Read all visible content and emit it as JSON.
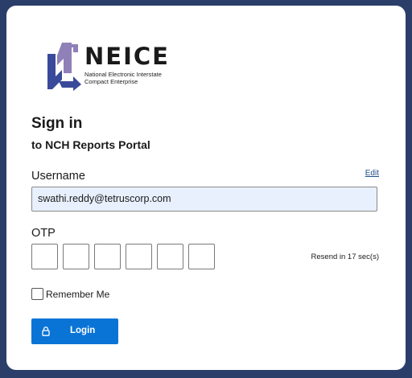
{
  "logo": {
    "wordmark": "NEICE",
    "tagline_line1": "National Electronic Interstate",
    "tagline_line2": "Compact Enterprise",
    "colors": {
      "blue": "#3a4a9a",
      "purple": "#8f80b8"
    }
  },
  "page": {
    "title": "Sign in",
    "subtitle": "to NCH Reports Portal"
  },
  "username": {
    "label": "Username",
    "edit_label": "Edit",
    "value": "swathi.reddy@tetruscorp.com"
  },
  "otp": {
    "label": "OTP",
    "digits": [
      "",
      "",
      "",
      "",
      "",
      ""
    ],
    "resend_text": "Resend in 17 sec(s)"
  },
  "remember": {
    "label": "Remember Me",
    "checked": false
  },
  "login": {
    "label": "Login",
    "icon": "lock-icon",
    "color": "#0a74d6"
  },
  "colors": {
    "background": "#2b3e6a",
    "card": "#ffffff",
    "input_fill": "#e8f0fd",
    "link": "#1f4e8a"
  }
}
